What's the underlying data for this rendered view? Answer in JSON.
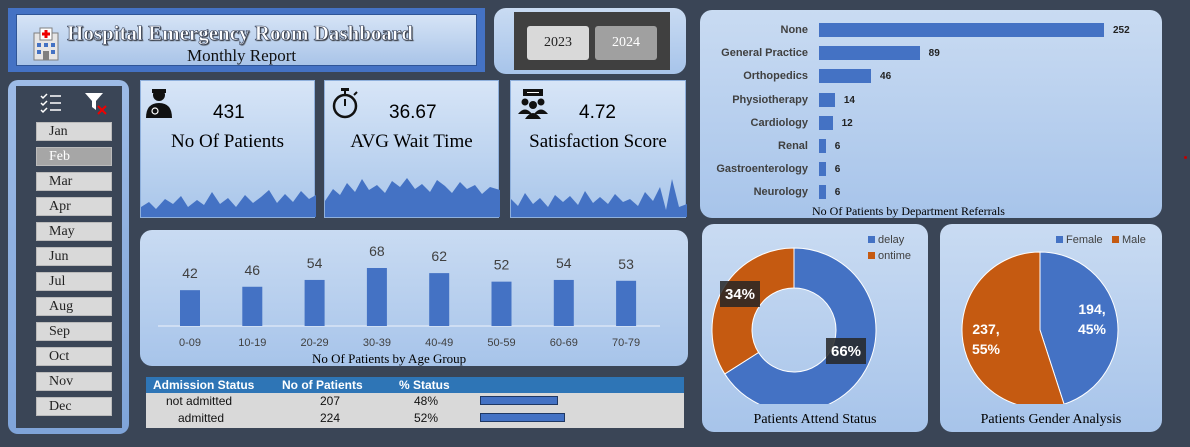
{
  "header": {
    "title": "Hospital Emergency Room Dashboard",
    "subtitle": "Monthly Report",
    "icon": "hospital-icon"
  },
  "years": {
    "items": [
      "2023",
      "2024"
    ],
    "selected": "2023"
  },
  "months": {
    "items": [
      "Jan",
      "Feb",
      "Mar",
      "Apr",
      "May",
      "Jun",
      "Jul",
      "Aug",
      "Sep",
      "Oct",
      "Nov",
      "Dec"
    ],
    "selected": "Feb",
    "icons": [
      "multi-select-icon",
      "clear-filter-icon"
    ]
  },
  "kpis": [
    {
      "value": "431",
      "label": "No Of Patients",
      "icon": "doctor-icon"
    },
    {
      "value": "36.67",
      "label": "AVG Wait Time",
      "icon": "stopwatch-icon"
    },
    {
      "value": "4.72",
      "label": "Satisfaction Score",
      "icon": "people-icon"
    }
  ],
  "colors": {
    "accent": "#4472c4",
    "orange": "#c55a11",
    "panel": "#b4cdee",
    "background": "#3a4556"
  },
  "chart_data": [
    {
      "type": "bar",
      "orientation": "horizontal",
      "title": "No Of Patients by Department Referrals",
      "categories": [
        "None",
        "General Practice",
        "Orthopedics",
        "Physiotherapy",
        "Cardiology",
        "Renal",
        "Gastroenterology",
        "Neurology"
      ],
      "values": [
        252,
        89,
        46,
        14,
        12,
        6,
        6,
        6
      ]
    },
    {
      "type": "bar",
      "title": "No Of Patients by Age Group",
      "categories": [
        "0-09",
        "10-19",
        "20-29",
        "30-39",
        "40-49",
        "50-59",
        "60-69",
        "70-79"
      ],
      "values": [
        42,
        46,
        54,
        68,
        62,
        52,
        54,
        53
      ]
    },
    {
      "type": "pie",
      "subtype": "donut",
      "title": "Patients Attend Status",
      "categories": [
        "delay",
        "ontime"
      ],
      "values": [
        66,
        34
      ],
      "labels": [
        "66%",
        "34%"
      ]
    },
    {
      "type": "pie",
      "title": "Patients Gender Analysis",
      "categories": [
        "Female",
        "Male"
      ],
      "values": [
        194,
        237
      ],
      "percents": [
        45,
        55
      ],
      "labels": [
        [
          "194,",
          "45%"
        ],
        [
          "237,",
          "55%"
        ]
      ]
    }
  ],
  "admission": {
    "headers": [
      "Admission Status",
      "No of Patients",
      "% Status"
    ],
    "rows": [
      {
        "status": "not admitted",
        "count": "207",
        "pct": "48%",
        "fraction": 0.48
      },
      {
        "status": "admitted",
        "count": "224",
        "pct": "52%",
        "fraction": 0.52
      }
    ]
  }
}
